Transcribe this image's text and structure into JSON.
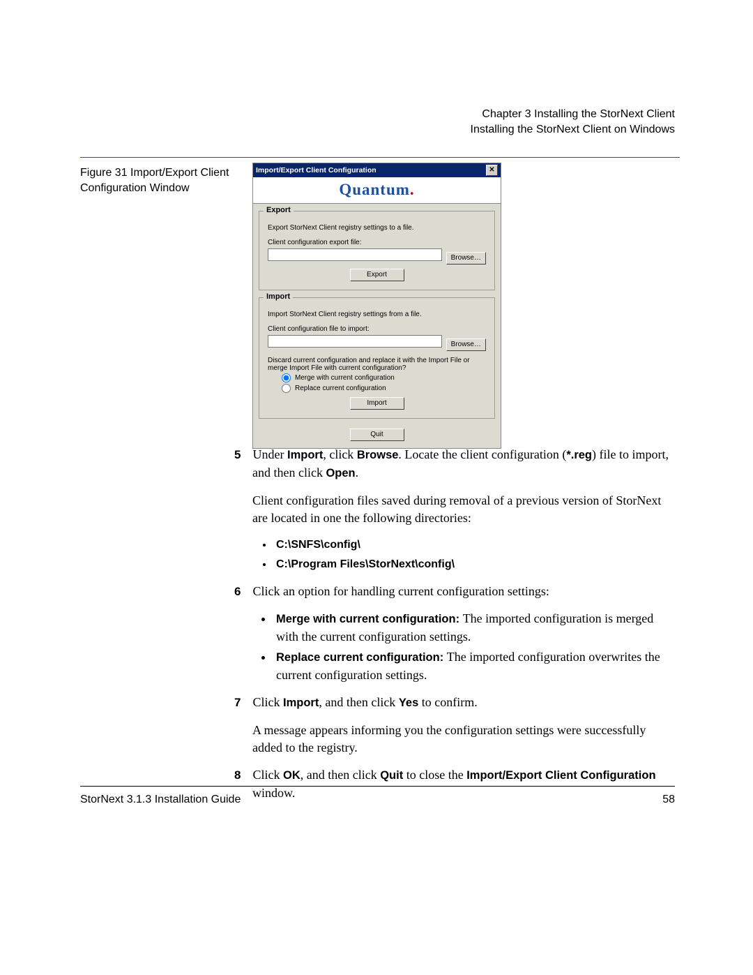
{
  "header": {
    "line1": "Chapter 3  Installing the StorNext Client",
    "line2": "Installing the StorNext Client on Windows"
  },
  "figure_label": "Figure 31  Import/Export Client Configuration Window",
  "dialog": {
    "title": "Import/Export Client Configuration",
    "brand": "Quantum",
    "export_group": {
      "legend": "Export",
      "desc": "Export StorNext Client registry settings to a file.",
      "field_label": "Client configuration export file:",
      "browse": "Browse…",
      "btn": "Export"
    },
    "import_group": {
      "legend": "Import",
      "desc": "Import StorNext Client registry settings from a file.",
      "field_label": "Client configuration file to import:",
      "browse": "Browse…",
      "question": "Discard current configuration and replace it with the Import File or merge Import File with current configuration?",
      "opt_merge": "Merge with current configuration",
      "opt_replace": "Replace current configuration",
      "btn": "Import"
    },
    "quit": "Quit"
  },
  "steps": {
    "s5": {
      "num": "5",
      "t1": "Under ",
      "b1": "Import",
      "t2": ", click ",
      "b2": "Browse",
      "t3": ". Locate the client configuration (",
      "b3": "*.reg",
      "t4": ") file to import, and then click ",
      "b4": "Open",
      "t5": "."
    },
    "note": "Client configuration files saved during removal of a previous version of StorNext are located in one the following directories:",
    "paths": {
      "p1": "C:\\SNFS\\config\\",
      "p2": "C:\\Program Files\\StorNext\\config\\"
    },
    "s6": {
      "num": "6",
      "text": "Click an option for handling current configuration settings:",
      "b1lead": "Merge with current configuration: ",
      "b1rest": "The imported configuration is merged with the current configuration settings.",
      "b2lead": "Replace current configuration: ",
      "b2rest": "The imported configuration overwrites the current configuration settings."
    },
    "s7": {
      "num": "7",
      "t1": "Click ",
      "b1": "Import",
      "t2": ", and then click ",
      "b2": "Yes",
      "t3": " to confirm.",
      "note": "A message appears informing you the configuration settings were successfully added to the registry."
    },
    "s8": {
      "num": "8",
      "t1": "Click ",
      "b1": "OK",
      "t2": ", and then click ",
      "b2": "Quit",
      "t3": " to close the ",
      "b3": "Import/Export Client Configuration",
      "t4": " window."
    }
  },
  "footer": {
    "left": "StorNext 3.1.3 Installation Guide",
    "right": "58"
  }
}
